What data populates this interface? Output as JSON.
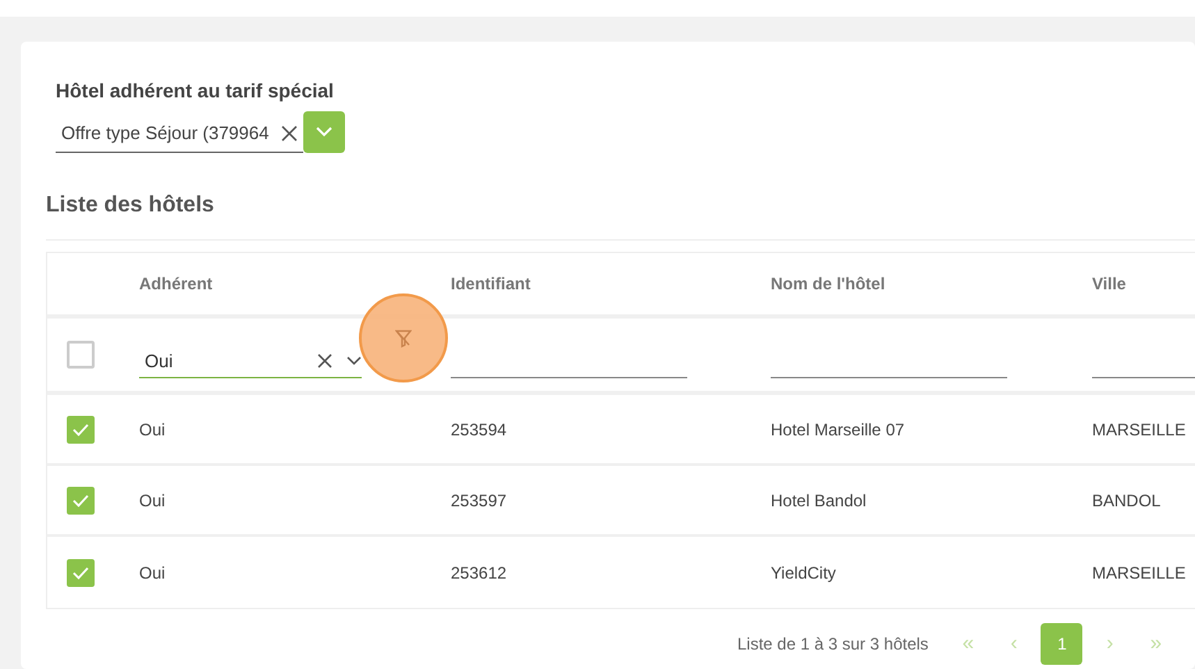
{
  "tariff_field": {
    "label": "Hôtel adhérent au tarif spécial",
    "value": "Offre type Séjour (379964"
  },
  "section_title": "Liste des hôtels",
  "table": {
    "columns": [
      "Adhérent",
      "Identifiant",
      "Nom de l'hôtel",
      "Ville"
    ],
    "select_all": {
      "checked": false
    },
    "filters": [
      {
        "value": "Oui"
      }
    ],
    "rows": [
      {
        "checked": true,
        "cells": [
          "Oui",
          "253594",
          "Hotel Marseille 07",
          "MARSEILLE"
        ]
      },
      {
        "checked": true,
        "cells": [
          "Oui",
          "253597",
          "Hotel Bandol",
          "BANDOL"
        ]
      },
      {
        "checked": true,
        "cells": [
          "Oui",
          "253612",
          "YieldCity",
          "MARSEILLE"
        ]
      }
    ]
  },
  "pagination": {
    "summary": "Liste de 1 à 3 sur 3 hôtels",
    "first": "«",
    "prev": "‹",
    "pages": [
      {
        "label": "1",
        "selected": true
      }
    ],
    "next": "›",
    "last": "»"
  }
}
